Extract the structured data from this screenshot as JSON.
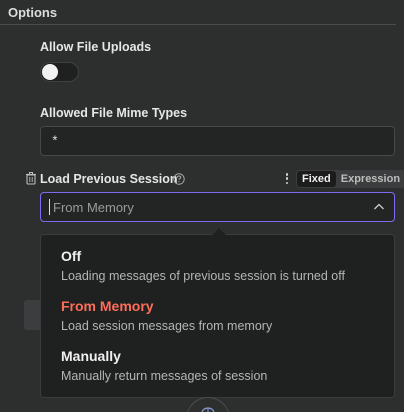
{
  "section": {
    "title": "Options"
  },
  "file_uploads": {
    "label": "Allow File Uploads",
    "enabled": false
  },
  "mime_types": {
    "label": "Allowed File Mime Types",
    "value": "*"
  },
  "load_session": {
    "label": "Load Previous Session",
    "mode_fixed": "Fixed",
    "mode_expression": "Expression",
    "selected_value": "From Memory"
  },
  "dropdown": {
    "options": [
      {
        "title": "Off",
        "description": "Loading messages of previous session is turned off"
      },
      {
        "title": "From Memory",
        "description": "Load session messages from memory"
      },
      {
        "title": "Manually",
        "description": "Manually return messages of session"
      }
    ]
  },
  "colors": {
    "accent": "#7c6cf0",
    "selected": "#ff6d5a",
    "background": "#2d2e2e"
  },
  "icons": {
    "trash": "trash-icon",
    "help": "help-circle-icon",
    "more": "kebab-menu-icon",
    "chevron": "chevron-up-icon"
  }
}
